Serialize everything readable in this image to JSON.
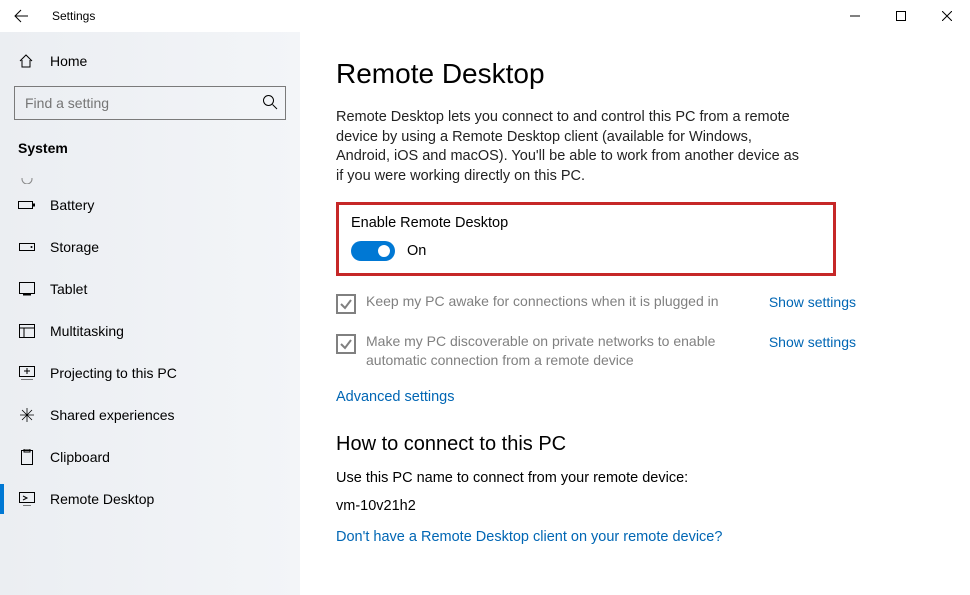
{
  "window": {
    "title": "Settings"
  },
  "sidebar": {
    "home_label": "Home",
    "section_label": "System",
    "items": [
      {
        "label": ""
      },
      {
        "label": "Battery"
      },
      {
        "label": "Storage"
      },
      {
        "label": "Tablet"
      },
      {
        "label": "Multitasking"
      },
      {
        "label": "Projecting to this PC"
      },
      {
        "label": "Shared experiences"
      },
      {
        "label": "Clipboard"
      },
      {
        "label": "Remote Desktop"
      }
    ]
  },
  "search": {
    "placeholder": "Find a setting"
  },
  "main": {
    "title": "Remote Desktop",
    "description": "Remote Desktop lets you connect to and control this PC from a remote device by using a Remote Desktop client (available for Windows, Android, iOS and macOS). You'll be able to work from another device as if you were working directly on this PC.",
    "enable": {
      "label": "Enable Remote Desktop",
      "state": "On"
    },
    "options": [
      {
        "text": "Keep my PC awake for connections when it is plugged in",
        "link": "Show settings"
      },
      {
        "text": "Make my PC discoverable on private networks to enable automatic connection from a remote device",
        "link": "Show settings"
      }
    ],
    "advanced_link": "Advanced settings",
    "connect": {
      "heading": "How to connect to this PC",
      "instruction": "Use this PC name to connect from your remote device:",
      "pc_name": "vm-10v21h2",
      "help_link": "Don't have a Remote Desktop client on your remote device?"
    }
  }
}
